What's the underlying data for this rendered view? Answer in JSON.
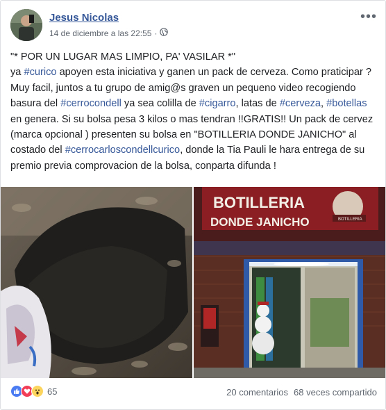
{
  "post": {
    "author": "Jesus Nicolas",
    "timestamp": "14 de diciembre a las 22:55",
    "privacy_icon": "globe-icon",
    "more_icon": "more-options-icon",
    "text_segments": [
      {
        "t": "\"* POR UN LUGAR MAS LIMPIO, PA' VASILAR *\"",
        "br": true
      },
      {
        "t": "ya "
      },
      {
        "t": "#curico",
        "tag": true
      },
      {
        "t": " apoyen esta iniciativa y ganen un pack de cerveza. Como praticipar ? Muy facil, juntos a tu grupo de amig@s graven un pequeno video recogiendo basura del "
      },
      {
        "t": "#cerrocondell",
        "tag": true
      },
      {
        "t": " ya sea colilla de "
      },
      {
        "t": "#cigarro",
        "tag": true
      },
      {
        "t": ", latas de "
      },
      {
        "t": "#cerveza",
        "tag": true
      },
      {
        "t": ", "
      },
      {
        "t": "#botellas",
        "tag": true
      },
      {
        "t": " en genera. Si su bolsa pesa 3 kilos o mas tendran !!GRATIS!! Un pack de cervez (marca opcional ) presenten su bolsa en \"BOTILLERIA DONDE JANICHO\" al costado del "
      },
      {
        "t": "#cerrocarloscondellcurico",
        "tag": true
      },
      {
        "t": ", donde la Tia Pauli le hara entrega de su premio previa comprovacion de la bolsa, conparta difunda !"
      }
    ],
    "store_sign_line1": "BOTILLERIA",
    "store_sign_line2": "DONDE JANICHO",
    "store_sign_small": "BOTILLERIA"
  },
  "footer": {
    "reaction_icons": [
      "like-icon",
      "love-icon",
      "wow-icon"
    ],
    "reaction_count": "65",
    "comments": "20 comentarios",
    "shares": "68 veces compartido"
  }
}
